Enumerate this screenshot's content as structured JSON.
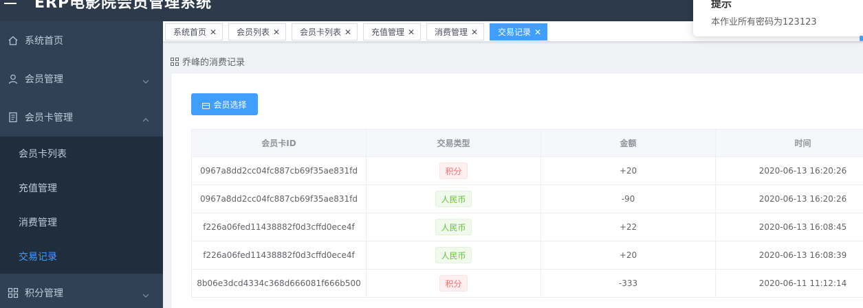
{
  "header": {
    "title": "ERP电影院会员管理系统"
  },
  "sidebar": {
    "items": [
      {
        "label": "系统首页"
      },
      {
        "label": "会员管理"
      },
      {
        "label": "会员卡管理"
      },
      {
        "label": "积分管理"
      }
    ],
    "subitems": [
      {
        "label": "会员卡列表"
      },
      {
        "label": "充值管理"
      },
      {
        "label": "消费管理"
      },
      {
        "label": "交易记录"
      }
    ]
  },
  "tags": [
    {
      "label": "系统首页"
    },
    {
      "label": "会员列表"
    },
    {
      "label": "会员卡列表"
    },
    {
      "label": "充值管理"
    },
    {
      "label": "消费管理"
    },
    {
      "label": "交易记录"
    }
  ],
  "page": {
    "heading": "乔峰的消费记录"
  },
  "actions": {
    "select_member": "会员选择"
  },
  "table": {
    "columns": [
      "会员卡ID",
      "交易类型",
      "金额",
      "时间"
    ],
    "rows": [
      {
        "id": "0967a8dd2cc04fc887cb69f35ae831fd",
        "type": "积分",
        "amount": "+20",
        "time": "2020-06-13 16:20:26"
      },
      {
        "id": "0967a8dd2cc04fc887cb69f35ae831fd",
        "type": "人民币",
        "amount": "-90",
        "time": "2020-06-13 16:20:26"
      },
      {
        "id": "f226a06fed11438882f0d3cffd0ece4f",
        "type": "人民币",
        "amount": "+22",
        "time": "2020-06-13 16:08:45"
      },
      {
        "id": "f226a06fed11438882f0d3cffd0ece4f",
        "type": "人民币",
        "amount": "+20",
        "time": "2020-06-13 16:08:39"
      },
      {
        "id": "8b06e3dcd4334c368d666081f666b500",
        "type": "积分",
        "amount": "-333",
        "time": "2020-06-11 11:12:14"
      }
    ]
  },
  "notification": {
    "title": "提示",
    "message": "本作业所有密码为123123"
  },
  "colors": {
    "primary": "#409eff",
    "sidebar": "#304156",
    "header": "#2d3a4b",
    "danger": "#f56c6c",
    "success": "#67c23a"
  }
}
